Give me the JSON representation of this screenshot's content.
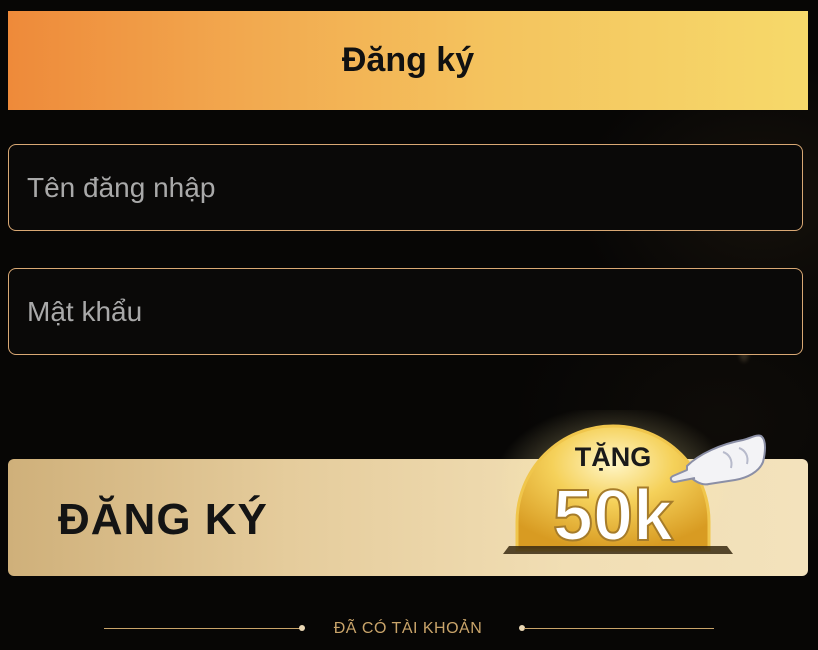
{
  "header": {
    "title": "Đăng ký"
  },
  "form": {
    "username": {
      "placeholder": "Tên đăng nhập",
      "value": ""
    },
    "password": {
      "placeholder": "Mật khẩu",
      "value": ""
    }
  },
  "register_button": {
    "label": "ĐĂNG KÝ",
    "badge_line1": "TẶNG",
    "badge_amount": "50k",
    "badge_icon": "pointing-hand-icon"
  },
  "footer": {
    "login_link": "ĐÃ CÓ TÀI KHOẢN"
  },
  "colors": {
    "header_gradient_start": "#ee8a3a",
    "header_gradient_end": "#f6d96a",
    "field_border": "#d9a874",
    "button_gradient_start": "#cfb07a",
    "button_gradient_end": "#f3e2bc",
    "badge_gold": "#f3c544",
    "link_color": "#c9a46a",
    "background": "#070605"
  }
}
